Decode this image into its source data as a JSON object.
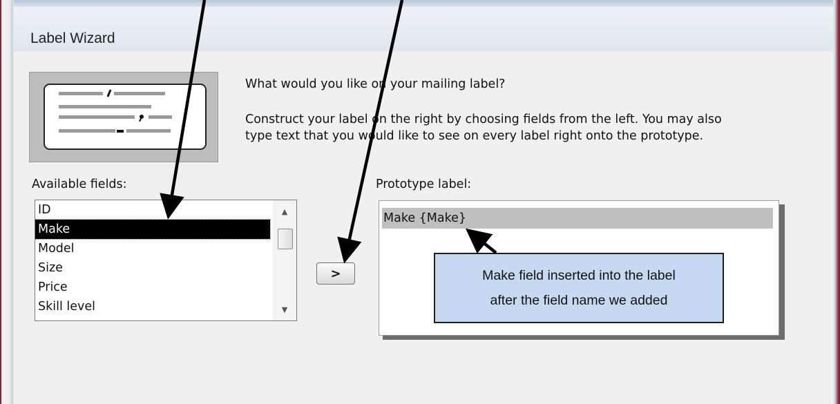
{
  "window": {
    "title": "Label Wizard"
  },
  "header": {
    "question": "What would you like on your mailing label?",
    "instructions_line1": "Construct your label on the right by choosing fields from the left. You may also",
    "instructions_line2": "type text that you would like to see on every label right onto the prototype."
  },
  "available_fields": {
    "label": "Available fields:",
    "items": [
      "ID",
      "Make",
      "Model",
      "Size",
      "Price",
      "Skill level"
    ],
    "selected": "Make"
  },
  "add_button": {
    "label": ">"
  },
  "prototype": {
    "label": "Prototype label:",
    "line1": "Make {Make}"
  },
  "callout": {
    "line1": "Make field inserted into the label",
    "line2": "after the field name we added",
    "fill_color": "#c6d9f1"
  },
  "colors": {
    "frame_accent": "#8a2433",
    "selection": "#000000"
  },
  "icons": [
    "label-preview-icon",
    "scroll-up-icon",
    "scroll-down-icon",
    "arrow-annotation-icon"
  ]
}
